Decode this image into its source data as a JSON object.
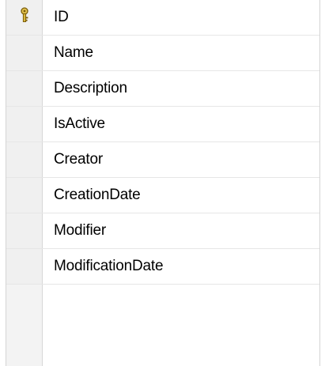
{
  "columns": [
    {
      "name": "ID",
      "is_primary_key": true,
      "key_icon": "primary-key-icon"
    },
    {
      "name": "Name"
    },
    {
      "name": "Description"
    },
    {
      "name": "IsActive"
    },
    {
      "name": "Creator"
    },
    {
      "name": "CreationDate"
    },
    {
      "name": "Modifier"
    },
    {
      "name": "ModificationDate"
    }
  ],
  "colors": {
    "row_header_bg": "#f0f0f0",
    "grid_line": "#e6e6e6",
    "key_gold": "#d6b43b"
  }
}
